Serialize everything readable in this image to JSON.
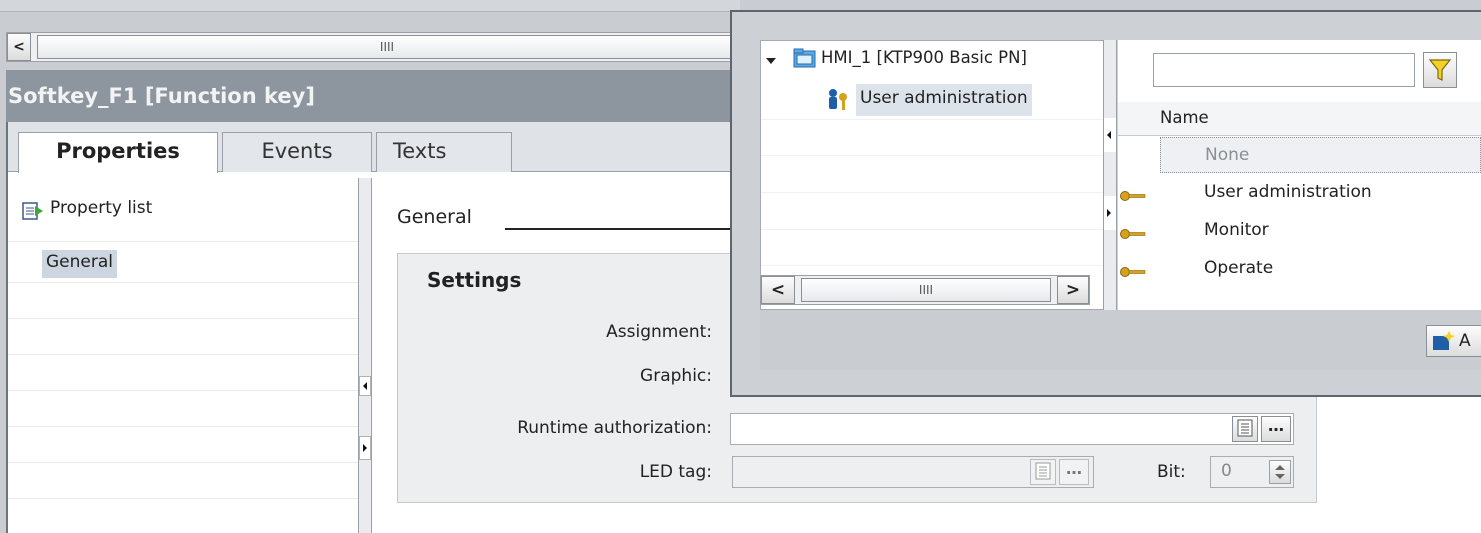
{
  "top_scrollbar": {
    "thumb_grip": "IIII",
    "left_arrow": "<"
  },
  "inspector": {
    "title": "Softkey_F1 [Function key]",
    "tabs": [
      {
        "label": "Properties",
        "active": true
      },
      {
        "label": "Events",
        "active": false
      },
      {
        "label": "Texts",
        "active": false
      }
    ],
    "nav": {
      "property_list_label": "Property list",
      "items": [
        {
          "label": "General",
          "selected": true
        }
      ]
    },
    "section_heading": "General",
    "settings": {
      "heading": "Settings",
      "fields": {
        "assignment_label": "Assignment:",
        "graphic_label": "Graphic:",
        "runtime_label": "Runtime authorization:",
        "runtime_value": "",
        "led_label": "LED tag:",
        "led_value": "",
        "bit_label": "Bit:",
        "bit_value": "0"
      }
    }
  },
  "popup": {
    "tree": {
      "root_label": "HMI_1 [KTP900 Basic PN]",
      "child_label": "User administration",
      "scroll_left": "<",
      "scroll_right": ">",
      "scroll_grip": "IIII"
    },
    "filter": {
      "placeholder": "",
      "value": ""
    },
    "table": {
      "header": "Name",
      "rows": [
        {
          "label": "None",
          "icon": "",
          "selected": true
        },
        {
          "label": "User administration",
          "icon": "key-icon",
          "selected": false
        },
        {
          "label": "Monitor",
          "icon": "key-icon",
          "selected": false
        },
        {
          "label": "Operate",
          "icon": "key-icon",
          "selected": false
        }
      ]
    },
    "add_button_label": "A"
  },
  "colors": {
    "inspector_title_bg": "#8d959e",
    "title_text": "#f2f3f4",
    "selected_bg": "#cdd6e0",
    "popup_footer_bg": "#c9ccd1",
    "key_icon": "#d6a21e",
    "filter_funnel": "#f4d028"
  }
}
